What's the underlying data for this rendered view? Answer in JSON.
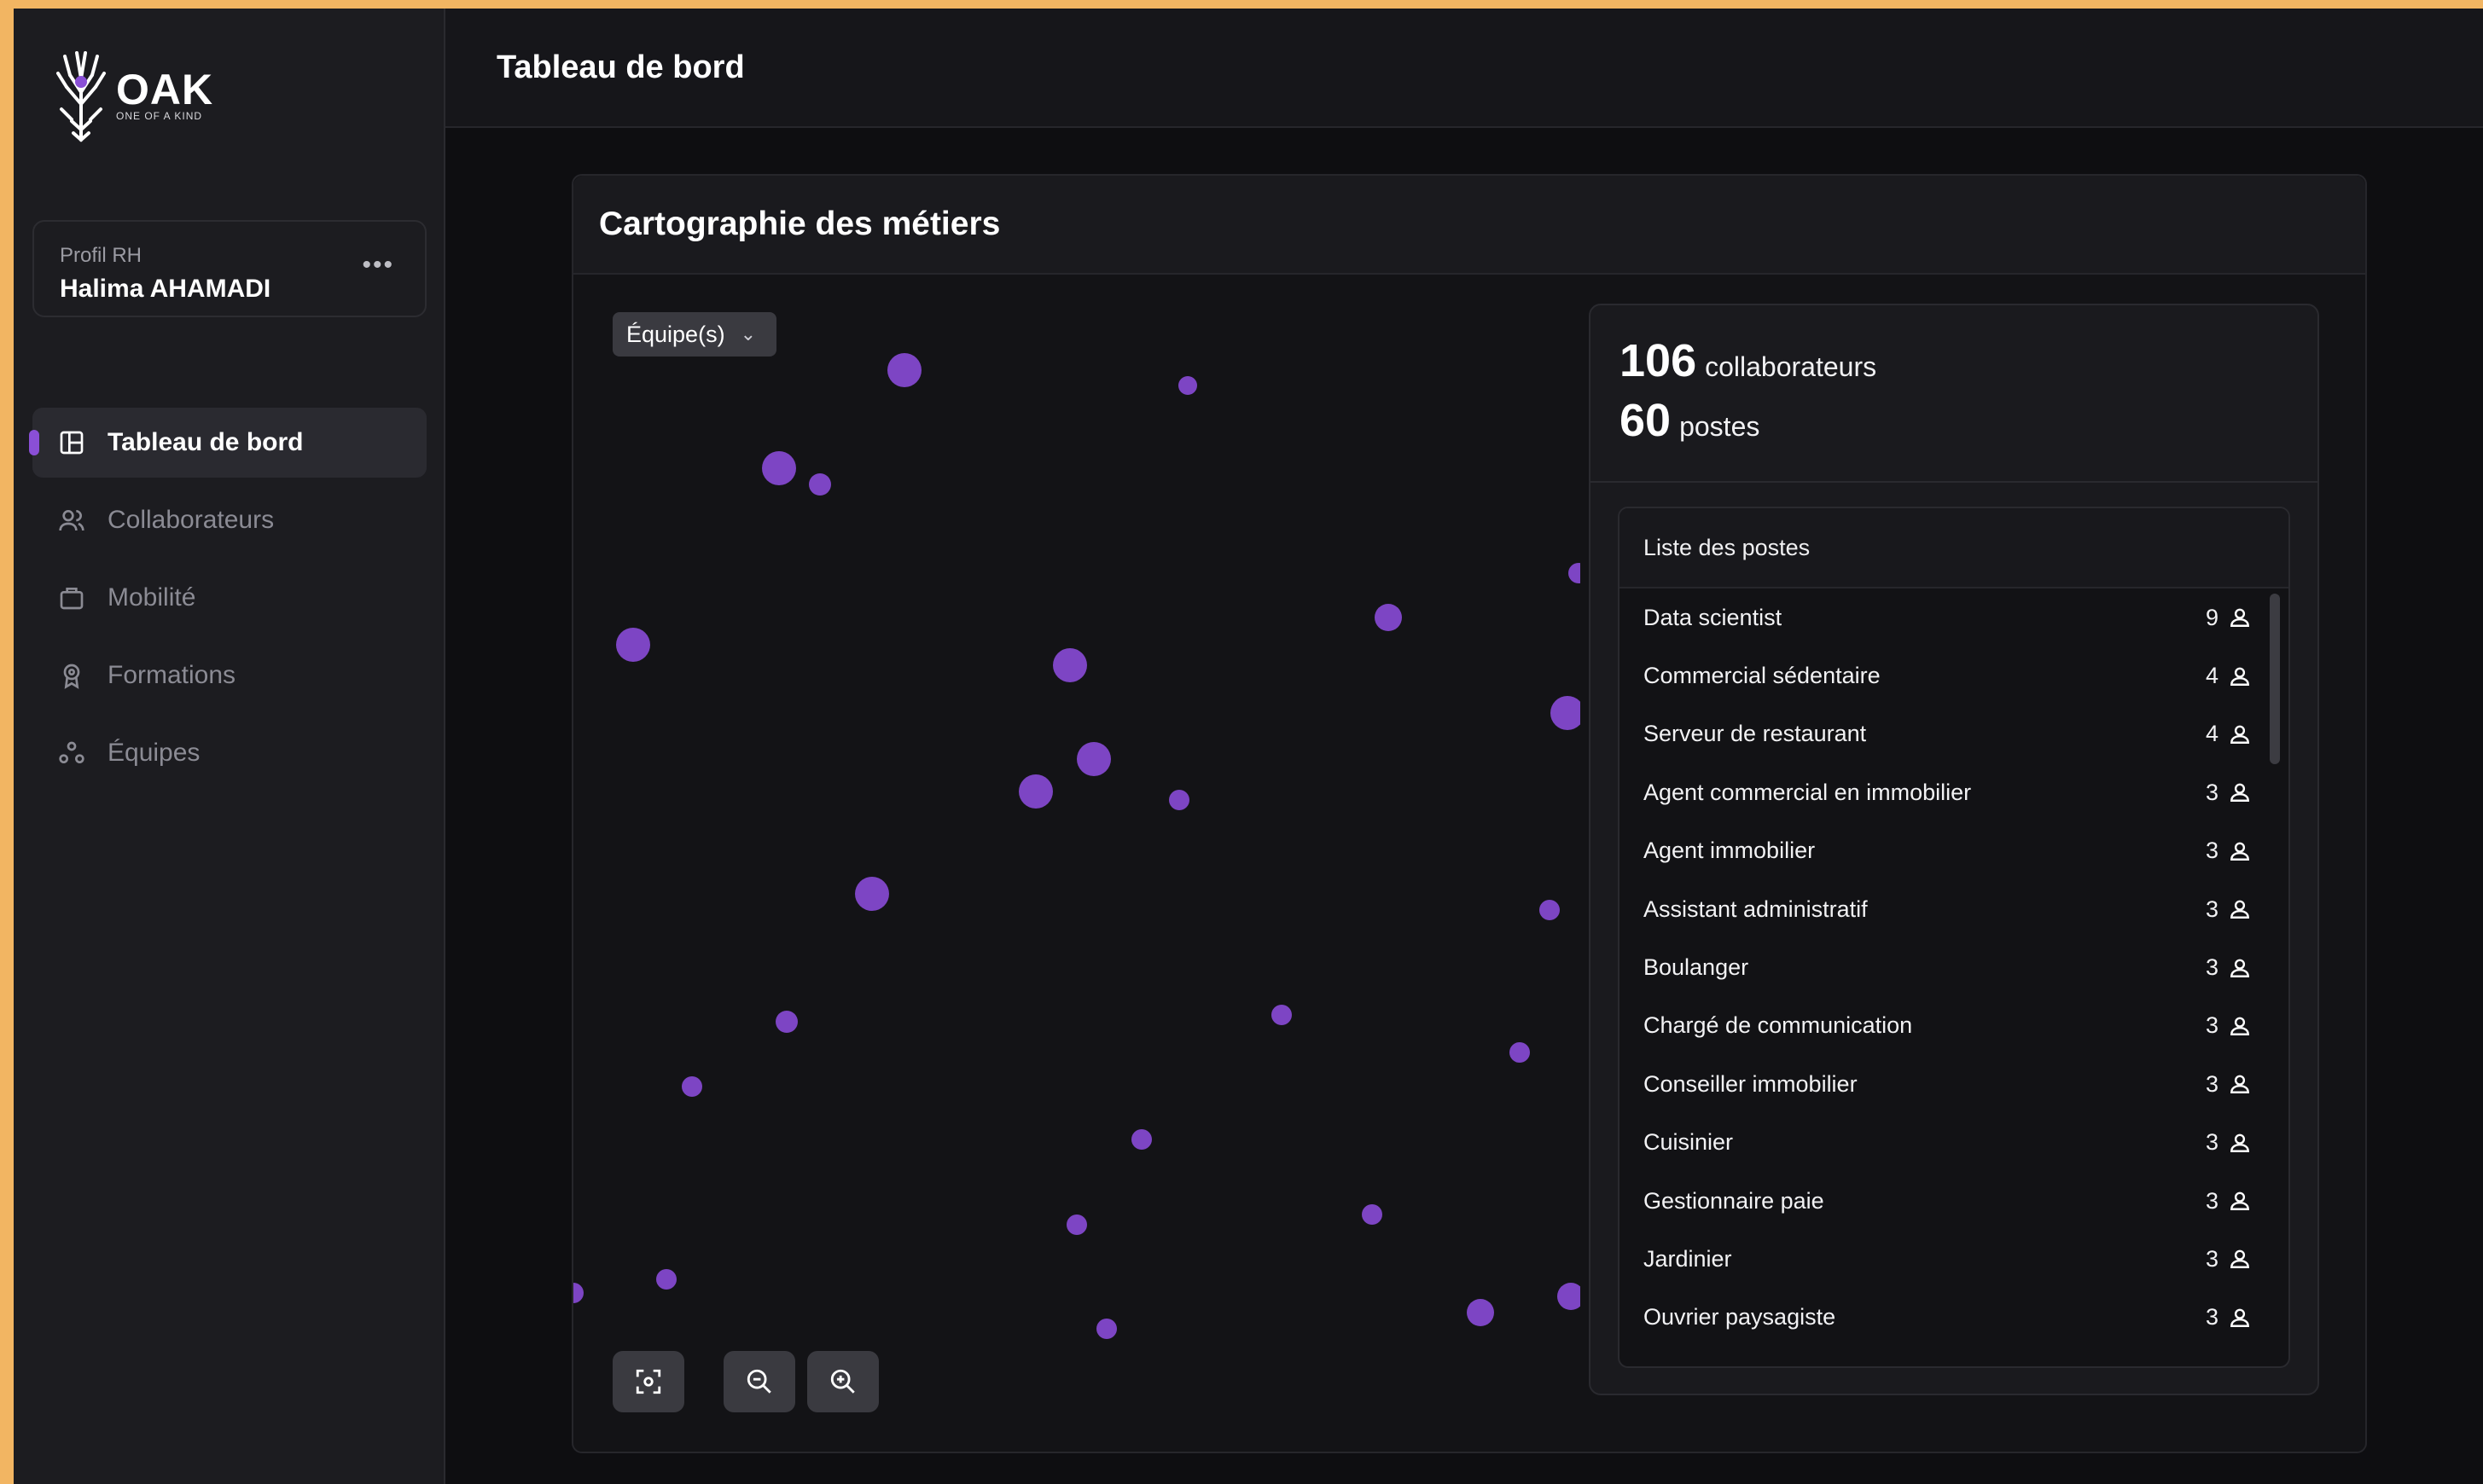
{
  "brand": {
    "name": "OAK",
    "tagline": "ONE OF A KIND",
    "accent": "#8a4fd6"
  },
  "profile": {
    "role": "Profil RH",
    "name": "Halima AHAMADI",
    "menu": "•••"
  },
  "nav": {
    "items": [
      {
        "label": "Tableau de bord",
        "icon": "layout-icon",
        "active": true
      },
      {
        "label": "Collaborateurs",
        "icon": "users-icon",
        "active": false
      },
      {
        "label": "Mobilité",
        "icon": "briefcase-icon",
        "active": false
      },
      {
        "label": "Formations",
        "icon": "award-icon",
        "active": false
      },
      {
        "label": "Équipes",
        "icon": "team-icon",
        "active": false
      }
    ]
  },
  "header": {
    "title": "Tableau de bord"
  },
  "card": {
    "title": "Cartographie des métiers"
  },
  "map": {
    "filter_label": "Équipe(s)",
    "controls": [
      "fit-view-icon",
      "zoom-out-icon",
      "zoom-in-icon"
    ],
    "node_color": "#7d45c4"
  },
  "stats": {
    "collaborators": {
      "value": "106",
      "label": "collaborateurs"
    },
    "positions": {
      "value": "60",
      "label": "postes"
    }
  },
  "positions_list": {
    "title": "Liste des postes",
    "rows": [
      {
        "name": "Data scientist",
        "count": "9"
      },
      {
        "name": "Commercial sédentaire",
        "count": "4"
      },
      {
        "name": "Serveur de restaurant",
        "count": "4"
      },
      {
        "name": "Agent commercial en immobilier",
        "count": "3"
      },
      {
        "name": "Agent immobilier",
        "count": "3"
      },
      {
        "name": "Assistant administratif",
        "count": "3"
      },
      {
        "name": "Boulanger",
        "count": "3"
      },
      {
        "name": "Chargé de communication",
        "count": "3"
      },
      {
        "name": "Conseiller immobilier",
        "count": "3"
      },
      {
        "name": "Cuisinier",
        "count": "3"
      },
      {
        "name": "Gestionnaire paie",
        "count": "3"
      },
      {
        "name": "Jardinier",
        "count": "3"
      },
      {
        "name": "Ouvrier paysagiste",
        "count": "3"
      }
    ]
  }
}
